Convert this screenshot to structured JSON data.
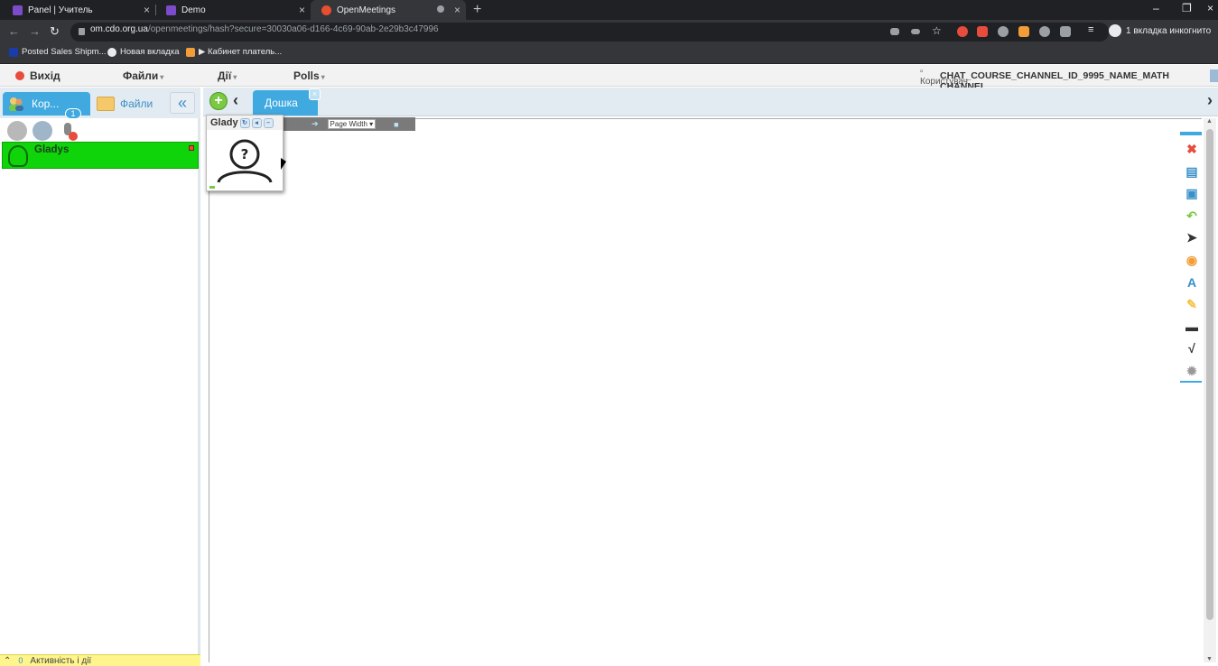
{
  "browser": {
    "tabs": [
      {
        "title": "Panel | Учитель",
        "icon_color": "#7b4bc9"
      },
      {
        "title": "Demo",
        "icon_color": "#7b4bc9"
      },
      {
        "title": "OpenMeetings",
        "icon_color": "#e84e30"
      }
    ],
    "new_tab": "+",
    "window_controls": [
      "–",
      "❐",
      "×"
    ],
    "url_host": "om.cdo.org.ua",
    "url_path": "/openmeetings/hash?secure=30030a06-d166-4c69-90ab-2e29b3c47996",
    "incognito_label": "1 вкладка инкогнито",
    "bookmarks": [
      {
        "label": "Posted Sales Shipm...",
        "icon_color": "#1a3ca8"
      },
      {
        "label": "Новая вкладка",
        "icon_color": "#e8eaed"
      },
      {
        "label": "▶ Кабинет платель...",
        "icon_color": "#f29d38"
      }
    ]
  },
  "menu": {
    "exit": "Вихід",
    "files": "Файли",
    "actions": "Дії",
    "polls": "Polls",
    "room_image_alt": "Користувач",
    "room_title": "CHAT_COURSE_CHANNEL_ID_9995_NAME_MATH CHANNEL"
  },
  "sidebar": {
    "tab_users": "Кор...",
    "tab_users_badge": "1",
    "tab_files": "Файли",
    "collapse": "«",
    "users": [
      {
        "name": "Gladys"
      }
    ],
    "activity_count": "0",
    "activity_label": "Активність і дії"
  },
  "whiteboard": {
    "add": "+",
    "prev": "‹",
    "next": "›",
    "tab_label": "Дошка",
    "tab_close": "×",
    "zoom_option": "Page Width ▾",
    "video_pod_name": "Glady",
    "tools": [
      {
        "name": "close-icon",
        "color": "#e74c3c"
      },
      {
        "name": "new-document-icon",
        "color": "#3a8fc7"
      },
      {
        "name": "save-icon",
        "color": "#3a8fc7"
      },
      {
        "name": "undo-icon",
        "color": "#7ac943"
      },
      {
        "name": "pointer-icon",
        "color": "#333333"
      },
      {
        "name": "pen-icon",
        "color": "#f29d38"
      },
      {
        "name": "text-icon",
        "color": "#3a8fc7"
      },
      {
        "name": "pencil-icon",
        "color": "#f5c342"
      },
      {
        "name": "eraser-icon",
        "color": "#333333"
      },
      {
        "name": "math-formula-icon",
        "color": "#333333"
      },
      {
        "name": "settings-icon",
        "color": "#999999"
      }
    ]
  }
}
